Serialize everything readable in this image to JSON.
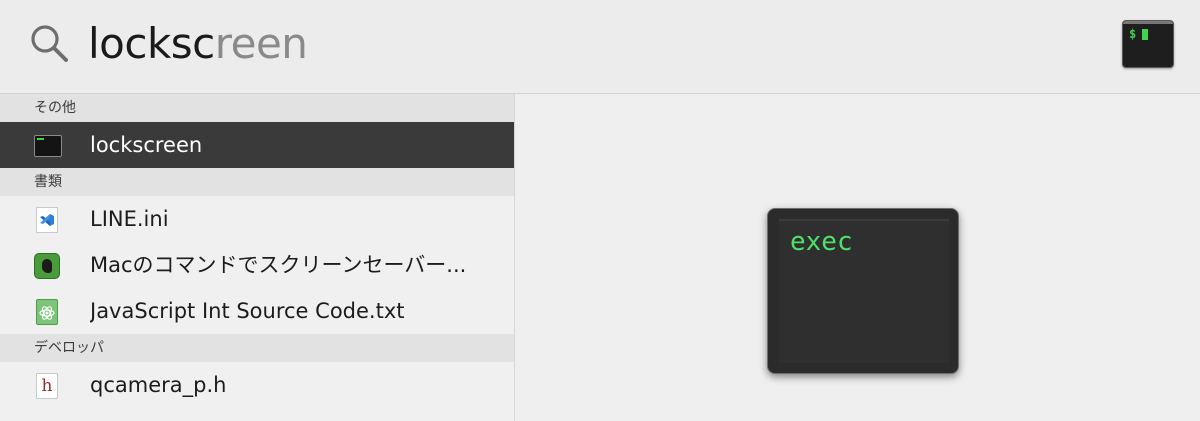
{
  "search": {
    "typed": "locksc",
    "completion": "reen",
    "top_hit_icon": "terminal-icon",
    "top_hit_prompt": "$"
  },
  "sections": [
    {
      "header": "その他",
      "items": [
        {
          "label": "lockscreen",
          "icon": "unix-executable-icon",
          "selected": true
        }
      ]
    },
    {
      "header": "書類",
      "items": [
        {
          "label": "LINE.ini",
          "icon": "vscode-document-icon",
          "selected": false
        },
        {
          "label": "Macのコマンドでスクリーンセーバー...",
          "icon": "evernote-icon",
          "selected": false
        },
        {
          "label": "JavaScript Int Source Code.txt",
          "icon": "text-document-icon",
          "selected": false
        }
      ]
    },
    {
      "header": "デベロッパ",
      "items": [
        {
          "label": "qcamera_p.h",
          "icon": "header-file-icon",
          "selected": false
        }
      ]
    }
  ],
  "preview": {
    "icon": "unix-executable-icon",
    "icon_text": "exec"
  },
  "colors": {
    "selection": "#3a3a3a",
    "terminal_green": "#4fe06a",
    "background": "#ececec"
  }
}
